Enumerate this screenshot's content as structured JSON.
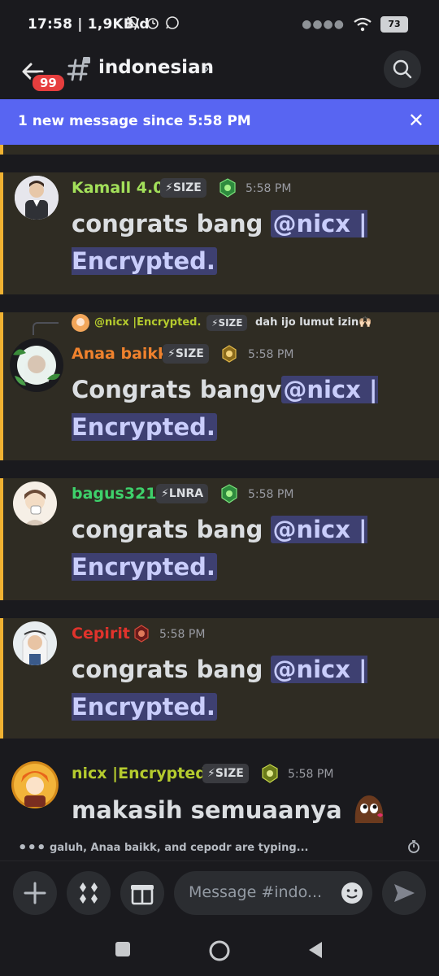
{
  "status": {
    "time": "17:58 | 1,9KB/d",
    "battery": "73"
  },
  "header": {
    "badge_count": "99",
    "channel_name": "indonesian",
    "chevron": "›"
  },
  "banner": {
    "text": "1 new message since 5:58 PM",
    "close": "✕"
  },
  "messages": [
    {
      "author": "Kamall 4.0",
      "author_color": "#a3e05a",
      "tag": "SIZE",
      "time": "5:58 PM",
      "text_plain": "congrats bang ",
      "mention": "@nicx | Encrypted."
    },
    {
      "reply_author": "@nicx |Encrypted.",
      "reply_tag": "SIZE",
      "reply_text": "dah ijo lumut izin🙌🏻",
      "author": "Anaa baikk",
      "author_color": "#f0822d",
      "tag": "SIZE",
      "time": "5:58 PM",
      "text_plain": "Congrats bangv",
      "mention": "@nicx | Encrypted."
    },
    {
      "author": "bagus321.",
      "author_color": "#3ed16b",
      "tag": "LNRA",
      "time": "5:58 PM",
      "text_plain": "congrats bang ",
      "mention": "@nicx | Encrypted."
    },
    {
      "author": "Cepirit",
      "author_color": "#e0332c",
      "time": "5:58 PM",
      "text_plain": "congrats bang ",
      "mention": "@nicx | Encrypted."
    },
    {
      "author": "nicx |Encrypted.",
      "author_color": "#b5cb2e",
      "tag": "SIZE",
      "time": "5:58 PM",
      "text_plain": "makasih semuaanya"
    }
  ],
  "typing": "galuh, Anaa baikk, and cepodr are typing...",
  "composer": {
    "placeholder": "Message #indo..."
  }
}
